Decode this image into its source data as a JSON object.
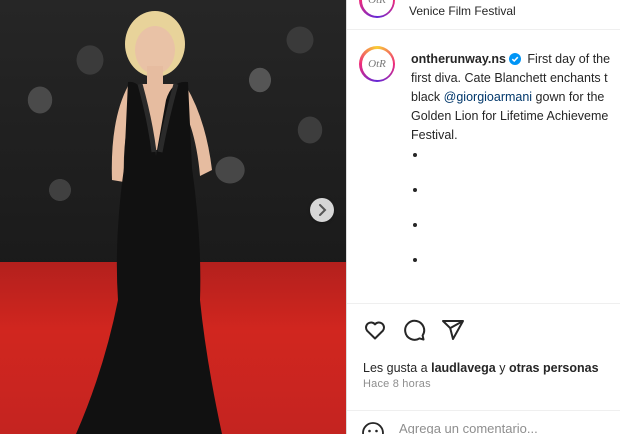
{
  "header": {
    "location": "Venice Film Festival",
    "avatar_initials": "OtR"
  },
  "post": {
    "username": "ontherunway.ns",
    "caption_lines": [
      "First day of the",
      "first diva. Cate Blanchett enchants t",
      "black ",
      " gown for the",
      "Golden Lion for Lifetime Achieveme",
      "Festival."
    ],
    "mention": "@giorgioarmani"
  },
  "actions": {
    "icons": [
      "heart-icon",
      "comment-icon",
      "share-icon"
    ]
  },
  "likes": {
    "prefix": "Les gusta a ",
    "user": "laudlavega",
    "connector": " y ",
    "others": "otras personas"
  },
  "timestamp": "Hace 8 horas",
  "comment": {
    "placeholder": "Agrega un comentario..."
  },
  "colors": {
    "carpet": "#c9221f",
    "link": "#00376b",
    "verified": "#0095f6"
  }
}
